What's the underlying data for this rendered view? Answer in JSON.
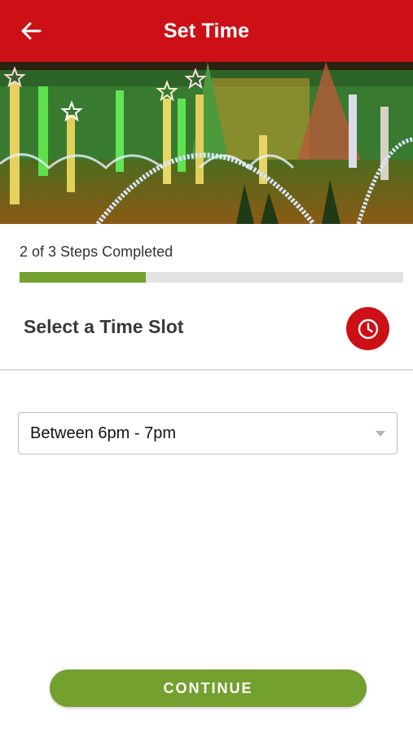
{
  "header": {
    "title": "Set Time",
    "back_icon": "arrow-left-icon",
    "background": "#cd0f16"
  },
  "hero": {
    "subject": "holiday lights display photo"
  },
  "progress": {
    "label": "2 of 3 Steps Completed",
    "completed_fraction": 0.33,
    "fill_color": "#73a02e"
  },
  "section": {
    "title": "Select a Time Slot",
    "icon": "clock-icon"
  },
  "time_slot": {
    "selected": "Between 6pm - 7pm",
    "caret_icon": "caret-down-icon"
  },
  "footer": {
    "continue_label": "CONTINUE",
    "button_color": "#73a02e"
  }
}
